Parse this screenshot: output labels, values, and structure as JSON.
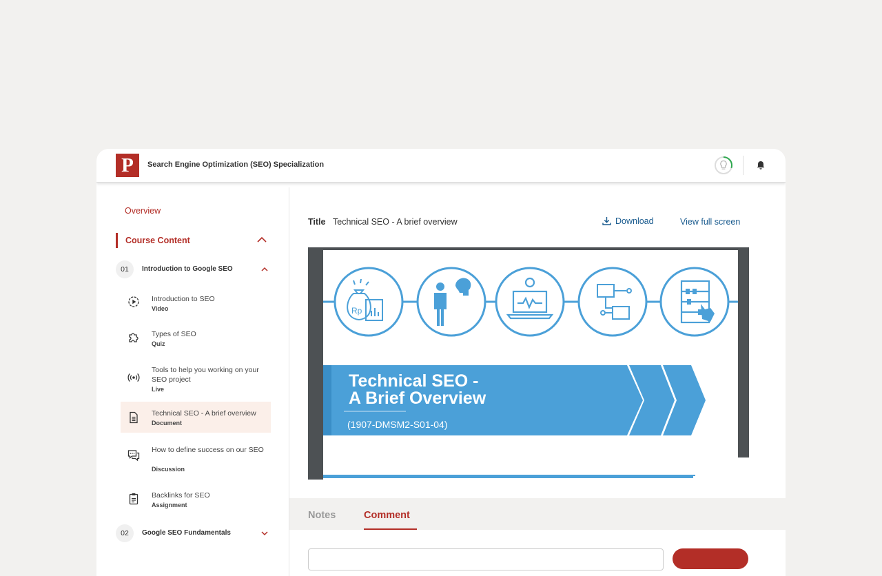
{
  "header": {
    "logo_letter": "P",
    "title": "Search Engine Optimization (SEO) Specialization",
    "icons": [
      "progress-ring-icon",
      "bell-icon"
    ],
    "progress_fraction": 0.3
  },
  "sidebar": {
    "overview_label": "Overview",
    "course_content_label": "Course Content",
    "modules": [
      {
        "number": "01",
        "title": "Introduction to Google SEO",
        "expanded": true,
        "lessons": [
          {
            "title": "Introduction to SEO",
            "type": "Video",
            "icon": "play-circle-icon"
          },
          {
            "title": "Types of SEO",
            "type": "Quiz",
            "icon": "puzzle-icon"
          },
          {
            "title": "Tools to help you working on your SEO project",
            "type": "Live",
            "icon": "broadcast-icon"
          },
          {
            "title": "Technical SEO - A brief overview",
            "type": "Document",
            "icon": "document-icon",
            "active": true
          },
          {
            "title": "How to define success on our SEO",
            "type": "Discussion",
            "icon": "chat-icon"
          },
          {
            "title": "Backlinks for SEO",
            "type": "Assignment",
            "icon": "clipboard-icon"
          }
        ]
      },
      {
        "number": "02",
        "title": "Google SEO Fundamentals",
        "expanded": false
      }
    ]
  },
  "main": {
    "title_label": "Title",
    "title_value": "Technical SEO - A brief overview",
    "download_label": "Download",
    "fullscreen_label": "View full screen",
    "slide": {
      "title_line1": "Technical SEO -",
      "title_line2": "A Brief Overview",
      "code": "(1907-DMSM2-S01-04)",
      "circle_icon_text": "Rp",
      "circle_icons": [
        "money-bag-icon",
        "presenter-icon",
        "laptop-chart-icon",
        "network-icon",
        "abacus-icon"
      ]
    },
    "tabs": [
      {
        "label": "Notes",
        "active": false
      },
      {
        "label": "Comment",
        "active": true
      }
    ]
  },
  "colors": {
    "brand": "#b32e27",
    "link": "#1b5c8f",
    "slide_blue": "#4ba0d8",
    "active_lesson_bg": "#fbefe9",
    "progress_green": "#2fa84f"
  }
}
